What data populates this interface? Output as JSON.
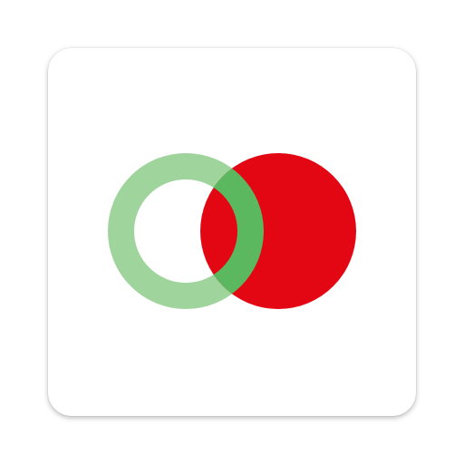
{
  "icon": {
    "name": "app-icon",
    "logo": {
      "name": "overlapping-circles-logo",
      "colors": {
        "tile_background": "#ffffff",
        "ring_green": "#9fd49d",
        "disc_red": "#e30613",
        "overlap_green": "#5cb85f"
      }
    }
  }
}
